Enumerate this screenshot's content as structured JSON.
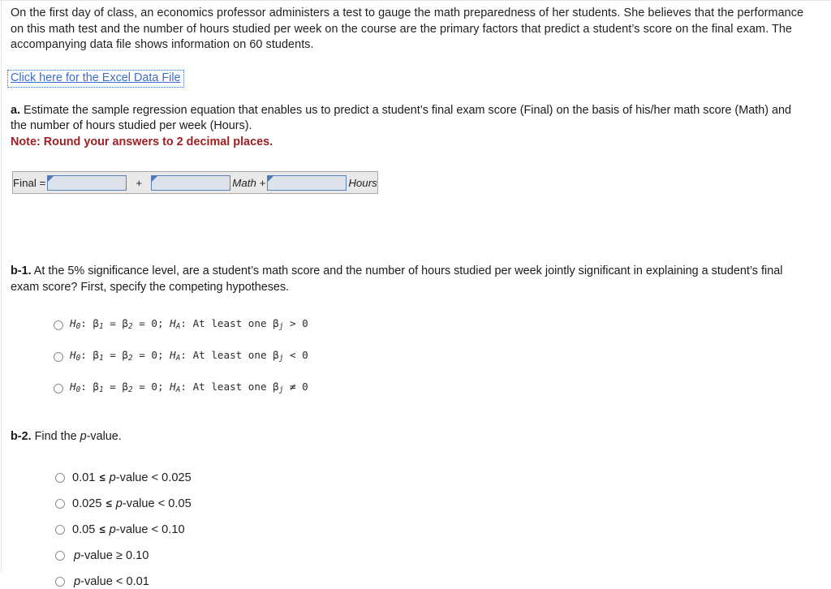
{
  "intro": {
    "paragraph": "On the first day of class, an economics professor administers a test to gauge the math preparedness of her students. She believes that the performance on this math test and the number of hours studied per week on the course are the primary factors that predict a student’s score on the final exam. The accompanying data file shows information on 60 students."
  },
  "datafile": {
    "link_label": "Click here for the Excel Data File",
    "link_color": "#3b6ecb"
  },
  "part_a": {
    "label": "a.",
    "prompt": " Estimate the sample regression equation that enables us to predict a student’s final exam score (Final) on the basis of his/her math score (Math) and the number of hours studied per week (Hours).",
    "note": "Note: Round your answers to 2 decimal places.",
    "note_color": "#9e1f24",
    "equation": {
      "lhs_label": "Final =",
      "intercept_value": "",
      "plus_label": "+",
      "slope1_value": "",
      "term1_label": "Math +",
      "slope2_value": "",
      "term2_label": "Hours"
    }
  },
  "part_b1": {
    "label": "b-1.",
    "prompt": " At the 5% significance level, are a student’s math score and the number of hours studied per week jointly significant in explaining a student’s final exam score? First, specify the competing hypotheses.",
    "options": [
      {
        "null_name": "H",
        "null_sub": "0",
        "null_body": ": β",
        "b1_sub": "1",
        "eq1": " = β",
        "b2_sub": "2",
        "eq2": " = 0; ",
        "alt_name": "H",
        "alt_sub": "A",
        "alt_body": ": At least one β",
        "bj_sub": "j",
        "relation": " > 0"
      },
      {
        "null_name": "H",
        "null_sub": "0",
        "null_body": ": β",
        "b1_sub": "1",
        "eq1": " = β",
        "b2_sub": "2",
        "eq2": " = 0; ",
        "alt_name": "H",
        "alt_sub": "A",
        "alt_body": ": At least one β",
        "bj_sub": "j",
        "relation": " < 0"
      },
      {
        "null_name": "H",
        "null_sub": "0",
        "null_body": ": β",
        "b1_sub": "1",
        "eq1": " = β",
        "b2_sub": "2",
        "eq2": " = 0; ",
        "alt_name": "H",
        "alt_sub": "A",
        "alt_body": ": At least one β",
        "bj_sub": "j",
        "relation": " ≠ 0"
      }
    ]
  },
  "part_b2": {
    "label": "b-2.",
    "prompt_pre": " Find the ",
    "prompt_em": "p",
    "prompt_post": "-value.",
    "options": [
      {
        "pre": "0.01 ",
        "op": "≤",
        "mid": " ",
        "em": "p",
        "post": "-value < 0.025"
      },
      {
        "pre": "0.025 ",
        "op": "≤",
        "mid": " ",
        "em": "p",
        "post": "-value < 0.05"
      },
      {
        "pre": "0.05 ",
        "op": "≤",
        "mid": " ",
        "em": "p",
        "post": "-value < 0.10"
      },
      {
        "pre": "",
        "op": "",
        "mid": "",
        "em": "p",
        "post": "-value ≥ 0.10"
      },
      {
        "pre": "",
        "op": "",
        "mid": "",
        "em": "p",
        "post": "-value < 0.01"
      }
    ]
  }
}
